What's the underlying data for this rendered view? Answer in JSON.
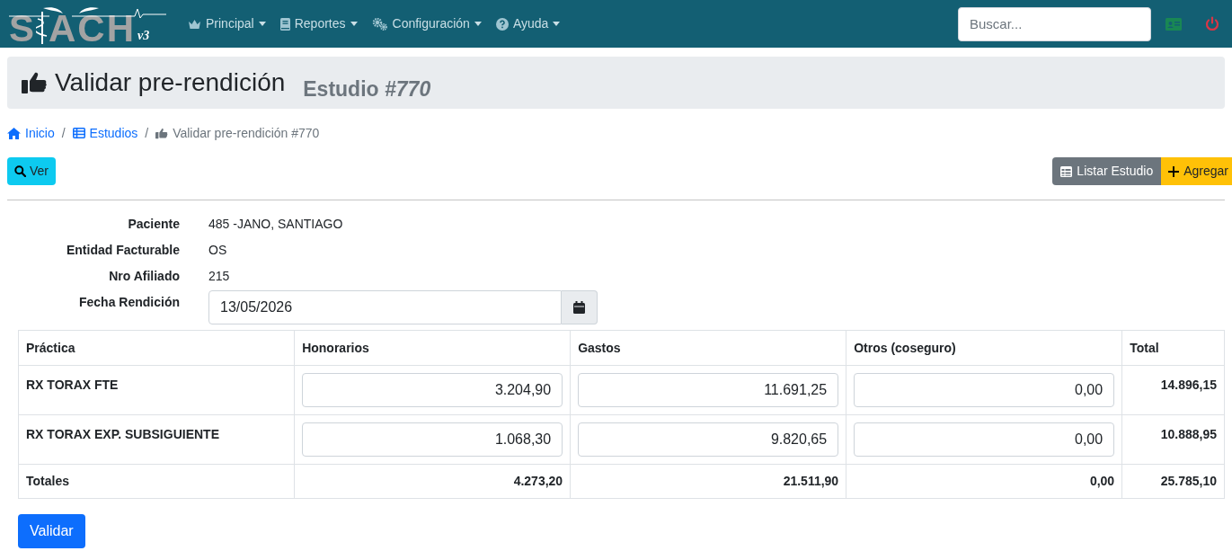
{
  "navbar": {
    "logo": {
      "left": "S",
      "right": "ACH",
      "version": "v3"
    },
    "menus": [
      {
        "label": "Principal"
      },
      {
        "label": "Reportes"
      },
      {
        "label": "Configuración"
      },
      {
        "label": "Ayuda"
      }
    ],
    "search": {
      "placeholder": "Buscar..."
    }
  },
  "header": {
    "title": "Validar pre-rendición",
    "subtitle": "Estudio ",
    "subtitle_number": "#770"
  },
  "breadcrumb": [
    {
      "label": "Inicio",
      "link": true
    },
    {
      "separator": "/",
      "label": "Estudios",
      "link": true
    },
    {
      "separator": "/",
      "label": "Validar pre-rendición #770",
      "link": false
    }
  ],
  "toolbar": {
    "view_button": "Ver",
    "list_button": "Listar Estudio",
    "add_button": "Agregar"
  },
  "fields": [
    {
      "kind": "text",
      "label": "Paciente",
      "value": "485 -JANO, SANTIAGO"
    },
    {
      "kind": "text",
      "label": "Entidad Facturable",
      "value": "OS"
    },
    {
      "kind": "text",
      "label": "Nro Afiliado",
      "value": "215"
    },
    {
      "kind": "date",
      "label": "Fecha Rendición",
      "value": "13/05/2026"
    }
  ],
  "table": {
    "columns": [
      "Práctica",
      "Honorarios",
      "Gastos",
      "Otros (coseguro)",
      "Total"
    ],
    "rows": [
      {
        "practica": "RX TORAX FTE",
        "honorarios": "3.204,90",
        "gastos": "11.691,25",
        "otros": "0,00",
        "total": "14.896,15"
      },
      {
        "practica": "RX TORAX EXP. SUBSIGUIENTE",
        "honorarios": "1.068,30",
        "gastos": "9.820,65",
        "otros": "0,00",
        "total": "10.888,95"
      }
    ],
    "totals": {
      "label": "Totales",
      "honorarios": "4.273,20",
      "gastos": "21.511,90",
      "otros": "0,00",
      "total": "25.785,10"
    }
  },
  "submit_button": "Validar"
}
